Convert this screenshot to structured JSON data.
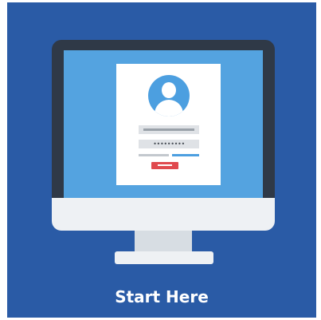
{
  "tile": {
    "label": "Start Here",
    "background_color": "#2a5ba6"
  },
  "illustration": {
    "device_icon": "desktop-monitor-icon",
    "avatar_icon": "user-avatar-icon",
    "password_mask": "•••••••••",
    "button_color": "#e0494e",
    "accent_color": "#4c9fe0"
  }
}
